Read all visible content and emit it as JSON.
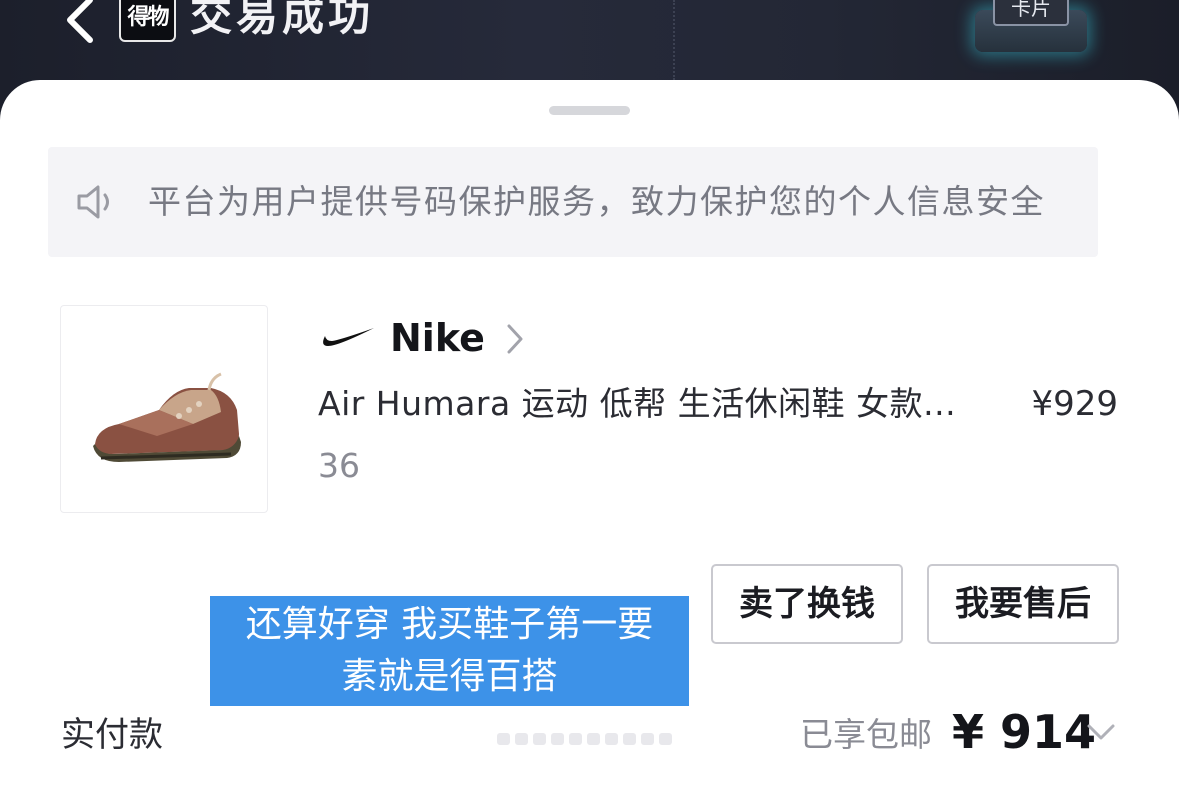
{
  "header": {
    "app_logo_text": "得物",
    "title": "交易成功",
    "card_badge": "卡片"
  },
  "notice": {
    "text": "平台为用户提供号码保护服务，致力保护您的个人信息安全"
  },
  "product": {
    "brand": "Nike",
    "title": "Air Humara 运动 低帮 生活休闲鞋 女款...",
    "price": "¥929",
    "size": "36"
  },
  "actions": {
    "sell_label": "卖了换钱",
    "after_sale_label": "我要售后"
  },
  "caption": {
    "line1": "还算好穿 我买鞋子第一要",
    "line2": "素就是得百搭"
  },
  "payment": {
    "label": "实付款",
    "shipping_note": "已享包邮",
    "amount": "¥ 914"
  },
  "icons": {
    "back": "chevron-left-icon",
    "speaker": "speaker-icon",
    "swoosh": "nike-swoosh-icon",
    "brand_link": "chevron-right-icon",
    "expand": "chevron-down-icon"
  },
  "colors": {
    "header_bg": "#1f2230",
    "caption_bg": "#3d92e8",
    "notice_bg": "#f4f4f7",
    "badge_glow": "#3cd2e6"
  }
}
